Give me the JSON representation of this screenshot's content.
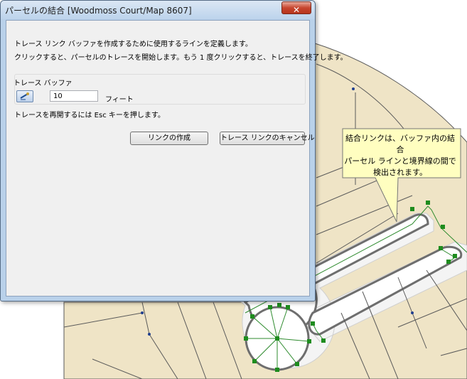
{
  "window": {
    "title": "パーセルの結合 [Woodmoss Court/Map 8607]",
    "close_glyph": "✕"
  },
  "dialog": {
    "instruction_1": "トレース リンク バッファを作成するために使用するラインを定義します。",
    "instruction_2": "クリックすると、パーセルのトレースを開始します。もう 1 度クリックすると、トレースを終了します。",
    "group_label": "トレース バッファ",
    "buffer_value": "10",
    "unit_label": "フィート",
    "esc_hint": "トレースを再開するには Esc キーを押します。",
    "create_button": "リンクの作成",
    "cancel_button": "トレース リンクのキャンセル",
    "tool_icon": "trace-tool-icon"
  },
  "callout": {
    "line1": "結合リンクは、バッファ内の結合",
    "line2": "パーセル ラインと境界線の間で",
    "line3": "検出されます。"
  },
  "colors": {
    "parcel_fill": "#efe4c6",
    "parcel_line": "#5a5a5a",
    "road_fill": "#ffffff",
    "buffer_fill": "#f5f5f5",
    "trace_line": "#2e8b2e",
    "node": "#1e8c1e",
    "callout_fill": "#fffec0"
  }
}
